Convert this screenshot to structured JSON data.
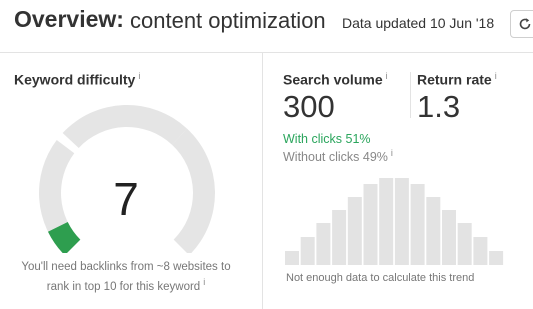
{
  "header": {
    "title_bold": "Overview:",
    "title_rest": "content optimization",
    "updated": "Data updated 10 Jun '18"
  },
  "keyword_difficulty": {
    "label": "Keyword difficulty",
    "info": "i",
    "value": "7",
    "note_line1": "You'll need backlinks from ~8 websites to",
    "note_line2": "rank in top 10 for this keyword",
    "note_info": "i",
    "gauge_fill_color": "#2e9e4f",
    "gauge_track_color": "#e5e5e5"
  },
  "search_volume": {
    "label": "Search volume",
    "info": "i",
    "value": "300",
    "with_clicks": "With clicks 51%",
    "without_clicks": "Without clicks 49%",
    "without_info": "i",
    "with_clicks_color": "#2aa55c"
  },
  "return_rate": {
    "label": "Return rate",
    "info": "i",
    "value": "1.3"
  },
  "trend": {
    "note": "Not enough data to calculate this trend",
    "bar_color": "#e3e3e3",
    "levels": [
      0.16,
      0.32,
      0.48,
      0.63,
      0.78,
      0.93,
      1.0,
      1.0,
      0.93,
      0.78,
      0.63,
      0.48,
      0.32,
      0.16
    ]
  }
}
